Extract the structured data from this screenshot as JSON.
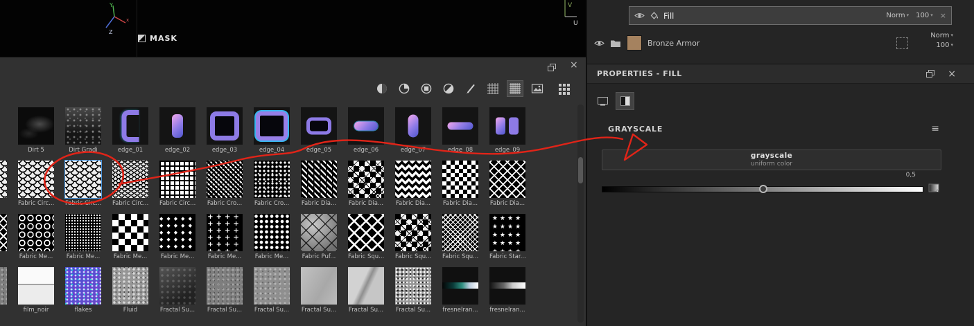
{
  "viewport": {
    "mask_label": "MASK",
    "axis3d": {
      "x": "x",
      "y": "Y",
      "z": "Z"
    },
    "axis2d": {
      "u": "U",
      "v": "V"
    }
  },
  "layers": {
    "fill": {
      "name": "Fill",
      "blend": "Norm",
      "opacity": "100"
    },
    "group": {
      "name": "Bronze Armor",
      "blend": "Norm",
      "opacity": "100",
      "thumbnail_color": "#a5825f"
    }
  },
  "properties": {
    "title": "PROPERTIES - FILL",
    "section_title": "GRAYSCALE",
    "value_button": {
      "title": "grayscale",
      "subtitle": "uniform color"
    },
    "slider": {
      "value_label": "0,5",
      "value": 0.5,
      "min": 0,
      "max": 1
    }
  },
  "glyphs": {
    "close": "×",
    "chevron_down": "▾",
    "menu": "≡"
  },
  "annotation": {
    "color": "#e02418"
  },
  "selection_color": "#4d9be6",
  "shelf": {
    "toolbar_icon_names": [
      "sphere-half-icon",
      "sphere-quarter-icon",
      "square-in-circle-icon",
      "sphere-diagonal-icon",
      "pencil-icon",
      "fine-grid-icon",
      "dense-grid-icon",
      "image-icon",
      "grid-view-icon"
    ],
    "rows": [
      [
        {
          "label": "Dirt 5",
          "pattern": "dirt5"
        },
        {
          "label": "Dirt Gradi",
          "pattern": "dirtgrad"
        },
        {
          "label": "edge_01",
          "pattern": "dark",
          "shape": "e1"
        },
        {
          "label": "edge_02",
          "pattern": "dark",
          "shape": "e2"
        },
        {
          "label": "edge_03",
          "pattern": "dark",
          "shape": "e3"
        },
        {
          "label": "edge_04",
          "pattern": "dark",
          "shape": "e4"
        },
        {
          "label": "edge_05",
          "pattern": "dark",
          "shape": "e5"
        },
        {
          "label": "edge_06",
          "pattern": "dark",
          "shape": "e6"
        },
        {
          "label": "edge_07",
          "pattern": "dark",
          "shape": "e7"
        },
        {
          "label": "edge_08",
          "pattern": "dark",
          "shape": "e8"
        },
        {
          "label": "edge_09",
          "pattern": "dark",
          "shape": "e9"
        }
      ],
      [
        {
          "partial": true,
          "pattern": "scale"
        },
        {
          "label": "Fabric Circ...",
          "pattern": "scale"
        },
        {
          "label": "Fabric Circ...",
          "pattern": "scale",
          "selected": true
        },
        {
          "label": "Fabric Circ...",
          "pattern": "scale-sm"
        },
        {
          "label": "Fabric Circ...",
          "pattern": "waffle"
        },
        {
          "label": "Fabric Cro...",
          "pattern": "weave"
        },
        {
          "label": "Fabric Cro...",
          "pattern": "dotring"
        },
        {
          "label": "Fabric Dia...",
          "pattern": "herring"
        },
        {
          "label": "Fabric Dia...",
          "pattern": "argyle"
        },
        {
          "label": "Fabric Dia...",
          "pattern": "zigzag"
        },
        {
          "label": "Fabric Dia...",
          "pattern": "diamondcheck"
        },
        {
          "label": "Fabric Dia...",
          "pattern": "lattice"
        }
      ],
      [
        {
          "partial": true,
          "pattern": "lattice"
        },
        {
          "label": "Fabric Me...",
          "pattern": "ringgrid"
        },
        {
          "label": "Fabric Me...",
          "pattern": "dotfine"
        },
        {
          "label": "Fabric Me...",
          "pattern": "diamondbig"
        },
        {
          "label": "Fabric Me...",
          "pattern": "glyph-sm",
          "glyph": "◆"
        },
        {
          "label": "Fabric Me...",
          "pattern": "glyph-plus",
          "glyph": "+"
        },
        {
          "label": "Fabric Me...",
          "pattern": "dotmed"
        },
        {
          "label": "Fabric Puf...",
          "pattern": "puff"
        },
        {
          "label": "Fabric Squ...",
          "pattern": "sqlattice"
        },
        {
          "label": "Fabric Squ...",
          "pattern": "argyle"
        },
        {
          "label": "Fabric Squ...",
          "pattern": "hatchdense"
        },
        {
          "label": "Fabric Star...",
          "pattern": "glyph-star",
          "glyph": "★"
        }
      ],
      [
        {
          "partial": true,
          "pattern": "fractal2"
        },
        {
          "label": "film_noir",
          "pattern": "filmnoir"
        },
        {
          "label": "flakes",
          "pattern": "flakes"
        },
        {
          "label": "Fluid",
          "pattern": "fluid"
        },
        {
          "label": "Fractal Su...",
          "pattern": "fractal1"
        },
        {
          "label": "Fractal Su...",
          "pattern": "fractal2"
        },
        {
          "label": "Fractal Su...",
          "pattern": "fractal3"
        },
        {
          "label": "Fractal Su...",
          "pattern": "fractal4"
        },
        {
          "label": "Fractal Su...",
          "pattern": "fractal5"
        },
        {
          "label": "Fractal Su...",
          "pattern": "fractal6"
        },
        {
          "label": "fresnelran...",
          "pattern": "fresnel1"
        },
        {
          "label": "fresnelran...",
          "pattern": "fresnel2"
        }
      ]
    ]
  }
}
